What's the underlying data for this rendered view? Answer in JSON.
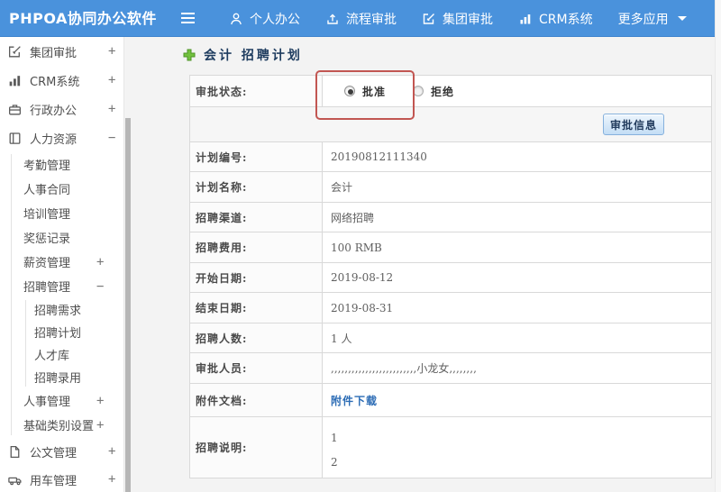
{
  "colors": {
    "topbar_blue": "#4a92dc",
    "highlight_red": "#c25652",
    "link_blue": "#2c6cb5",
    "title_navy": "#1e3c5f",
    "button_border_blue": "#86b1dd"
  },
  "topbar": {
    "logo": "PHPOA协同办公软件",
    "nav": [
      {
        "label": "个人办公",
        "icon": "person-icon"
      },
      {
        "label": "流程审批",
        "icon": "process-icon"
      },
      {
        "label": "集团审批",
        "icon": "edit-icon"
      },
      {
        "label": "CRM系统",
        "icon": "bar-chart-icon"
      },
      {
        "label": "更多应用",
        "icon": "caret-down-icon"
      }
    ]
  },
  "sidebar": {
    "items": {
      "group_approval": {
        "label": "集团审批",
        "exp": "+"
      },
      "crm": {
        "label": "CRM系统",
        "exp": "+"
      },
      "admin": {
        "label": "行政办公",
        "exp": "+"
      },
      "hr": {
        "label": "人力资源",
        "exp": "−"
      },
      "attendance": {
        "label": "考勤管理"
      },
      "contract": {
        "label": "人事合同"
      },
      "training": {
        "label": "培训管理"
      },
      "rewards": {
        "label": "奖惩记录"
      },
      "salary": {
        "label": "薪资管理",
        "exp": "+"
      },
      "recruit": {
        "label": "招聘管理",
        "exp": "−"
      },
      "recruit_need": {
        "label": "招聘需求"
      },
      "recruit_plan": {
        "label": "招聘计划"
      },
      "talent_pool": {
        "label": "人才库"
      },
      "recruit_hire": {
        "label": "招聘录用"
      },
      "personnel": {
        "label": "人事管理",
        "exp": "+"
      },
      "base_category": {
        "label": "基础类别设置",
        "exp": "+"
      },
      "doc_mgmt": {
        "label": "公文管理",
        "exp": "+"
      },
      "vehicle": {
        "label": "用车管理",
        "exp": "+"
      }
    }
  },
  "main": {
    "title": "会计 招聘计划",
    "status_label": "审批状态:",
    "options": [
      {
        "label": "批准",
        "checked": true
      },
      {
        "label": "拒绝",
        "checked": false
      }
    ],
    "approve_info_button": "审批信息",
    "rows": [
      {
        "label": "计划编号:",
        "value": "20190812111340"
      },
      {
        "label": "计划名称:",
        "value": "会计"
      },
      {
        "label": "招聘渠道:",
        "value": "网络招聘"
      },
      {
        "label": "招聘费用:",
        "value": "100 RMB"
      },
      {
        "label": "开始日期:",
        "value": "2019-08-12"
      },
      {
        "label": "结束日期:",
        "value": "2019-08-31"
      },
      {
        "label": "招聘人数:",
        "value": "1 人"
      },
      {
        "label": "审批人员:",
        "value": ",,,,,,,,,,,,,,,,,,,,,,,,,小龙女,,,,,,,,"
      },
      {
        "label": "附件文档:",
        "value": "附件下载"
      },
      {
        "label": "招聘说明:",
        "lines": [
          "1",
          "2"
        ]
      }
    ]
  }
}
